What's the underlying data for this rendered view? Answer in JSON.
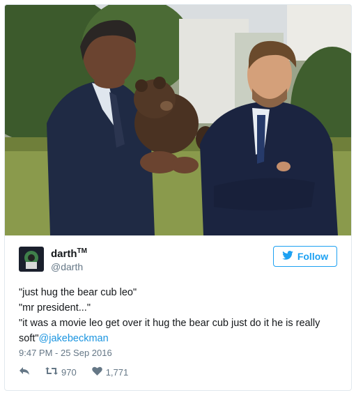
{
  "photo": {
    "icon": "tweet-photo"
  },
  "user": {
    "display_name": "darth",
    "tm_mark": "TM",
    "handle": "@darth",
    "avatar_icon": "avatar"
  },
  "follow_button": {
    "label": "Follow",
    "color": "#1da1f2",
    "icon": "twitter-bird-icon"
  },
  "tweet": {
    "line1": "\"just hug the bear cub leo\"",
    "line2": "\"mr president...\"",
    "line3": "\"it was a movie leo get over it hug the bear cub just do it he is really soft\"",
    "mention": "@jakebeckman",
    "mention_color": "#1b95e0"
  },
  "timestamp": "9:47 PM - 25 Sep 2016",
  "actions": {
    "reply_icon": "reply-icon",
    "retweet_icon": "retweet-icon",
    "retweet_count": "970",
    "like_icon": "heart-icon",
    "like_count": "1,771"
  }
}
